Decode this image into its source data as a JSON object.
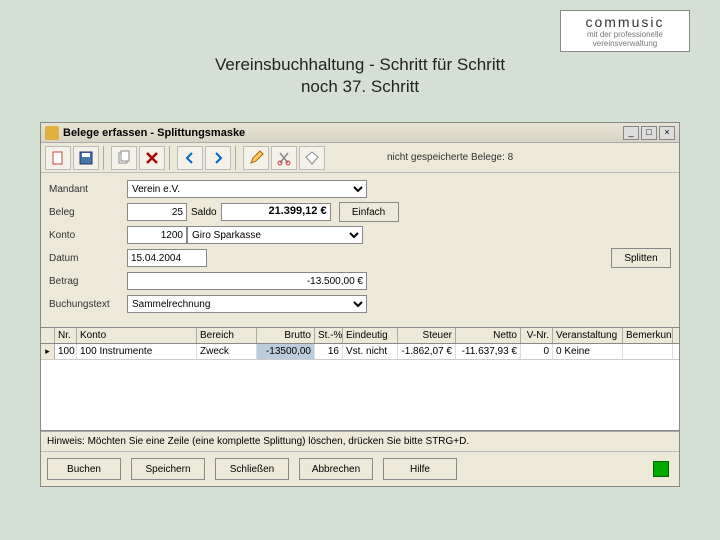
{
  "logo": {
    "title": "commusic",
    "sub1": "mit der professionelle",
    "sub2": "vereinsverwaltung"
  },
  "page": {
    "title": "Vereinsbuchhaltung - Schritt für Schritt",
    "sub": "noch 37. Schritt"
  },
  "window": {
    "title": "Belege erfassen - Splittungsmaske",
    "status": "nicht gespeicherte Belege: 8"
  },
  "form": {
    "mandant_lbl": "Mandant",
    "mandant_val": "Verein e.V.",
    "beleg_lbl": "Beleg",
    "beleg_val": "25",
    "saldo_lbl": "Saldo",
    "saldo_val": "21.399,12 €",
    "konto_lbl": "Konto",
    "konto_val": "1200",
    "konto_name": "Giro Sparkasse",
    "datum_lbl": "Datum",
    "datum_val": "15.04.2004",
    "betrag_lbl": "Betrag",
    "betrag_val": "-13.500,00 €",
    "buchtext_lbl": "Buchungstext",
    "buchtext_val": "Sammelrechnung",
    "btn_einfach": "Einfach",
    "btn_splitten": "Splitten"
  },
  "grid": {
    "headers": {
      "nr": "Nr.",
      "konto": "Konto",
      "bereich": "Bereich",
      "brutto": "Brutto",
      "st": "St.-%",
      "eindeutig": "Eindeutig",
      "steuer": "Steuer",
      "netto": "Netto",
      "vnr": "V-Nr.",
      "veranstaltung": "Veranstaltung",
      "bemerkung": "Bemerkung"
    },
    "row1": {
      "nr": "100",
      "konto": "100 Instrumente",
      "bereich": "Zweck",
      "brutto": "-13500,00",
      "st": "16",
      "eindeutig": "Vst. nicht",
      "steuer": "-1.862,07 €",
      "netto": "-11.637,93 €",
      "vnr": "0",
      "veranstaltung": "0 Keine",
      "bemerkung": ""
    }
  },
  "hint": "Hinweis: Möchten Sie eine Zeile (eine komplette Splittung) löschen, drücken Sie bitte STRG+D.",
  "footer": {
    "buchen": "Buchen",
    "speichern": "Speichern",
    "schliessen": "Schließen",
    "abbrechen": "Abbrechen",
    "hilfe": "Hilfe"
  }
}
